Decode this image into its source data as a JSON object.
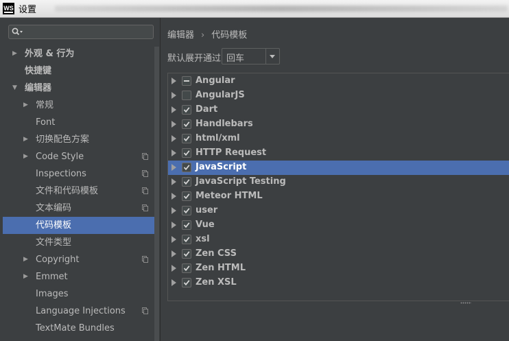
{
  "window": {
    "title": "设置",
    "app_icon_text": "WS"
  },
  "sidebar": {
    "search": {
      "placeholder": ""
    },
    "items": [
      {
        "label": "外观 & 行为",
        "expandable": true,
        "expanded": false,
        "bold": true,
        "selected": false,
        "copyable": false
      },
      {
        "label": "快捷键",
        "expandable": false,
        "bold": true,
        "selected": false,
        "copyable": false
      },
      {
        "label": "编辑器",
        "expandable": true,
        "expanded": true,
        "bold": true,
        "selected": false,
        "copyable": false
      },
      {
        "label": "常规",
        "expandable": true,
        "expanded": false,
        "bold": false,
        "selected": false,
        "copyable": false
      },
      {
        "label": "Font",
        "expandable": false,
        "bold": false,
        "selected": false,
        "copyable": false
      },
      {
        "label": "切换配色方案",
        "expandable": true,
        "expanded": false,
        "bold": false,
        "selected": false,
        "copyable": false
      },
      {
        "label": "Code Style",
        "expandable": true,
        "expanded": false,
        "bold": false,
        "selected": false,
        "copyable": true
      },
      {
        "label": "Inspections",
        "expandable": false,
        "bold": false,
        "selected": false,
        "copyable": true
      },
      {
        "label": "文件和代码模板",
        "expandable": false,
        "bold": false,
        "selected": false,
        "copyable": true
      },
      {
        "label": "文本编码",
        "expandable": false,
        "bold": false,
        "selected": false,
        "copyable": true
      },
      {
        "label": "代码模板",
        "expandable": false,
        "bold": false,
        "selected": true,
        "copyable": false
      },
      {
        "label": "文件类型",
        "expandable": false,
        "bold": false,
        "selected": false,
        "copyable": false
      },
      {
        "label": "Copyright",
        "expandable": true,
        "expanded": false,
        "bold": false,
        "selected": false,
        "copyable": true
      },
      {
        "label": "Emmet",
        "expandable": true,
        "expanded": false,
        "bold": false,
        "selected": false,
        "copyable": false
      },
      {
        "label": "Images",
        "expandable": false,
        "bold": false,
        "selected": false,
        "copyable": false
      },
      {
        "label": "Language Injections",
        "expandable": false,
        "bold": false,
        "selected": false,
        "copyable": true
      },
      {
        "label": "TextMate Bundles",
        "expandable": false,
        "bold": false,
        "selected": false,
        "copyable": false
      }
    ]
  },
  "main": {
    "breadcrumb": {
      "parent": "编辑器",
      "separator": "›",
      "current": "代码模板"
    },
    "expand_with": {
      "label": "默认展开通过",
      "value": "回车"
    },
    "template_groups": [
      {
        "name": "Angular",
        "state": "partial",
        "selected": false
      },
      {
        "name": "AngularJS",
        "state": "unchecked",
        "selected": false
      },
      {
        "name": "Dart",
        "state": "checked",
        "selected": false
      },
      {
        "name": "Handlebars",
        "state": "checked",
        "selected": false
      },
      {
        "name": "html/xml",
        "state": "checked",
        "selected": false
      },
      {
        "name": "HTTP Request",
        "state": "checked",
        "selected": false
      },
      {
        "name": "JavaScript",
        "state": "checked",
        "selected": true
      },
      {
        "name": "JavaScript Testing",
        "state": "checked",
        "selected": false
      },
      {
        "name": "Meteor HTML",
        "state": "checked",
        "selected": false
      },
      {
        "name": "user",
        "state": "checked",
        "selected": false
      },
      {
        "name": "Vue",
        "state": "checked",
        "selected": false
      },
      {
        "name": "xsl",
        "state": "checked",
        "selected": false
      },
      {
        "name": "Zen CSS",
        "state": "checked",
        "selected": false
      },
      {
        "name": "Zen HTML",
        "state": "checked",
        "selected": false
      },
      {
        "name": "Zen XSL",
        "state": "checked",
        "selected": false
      }
    ]
  },
  "colors": {
    "background": "#3c3f41",
    "selection": "#4b6eaf",
    "text": "#bbbbbb"
  }
}
